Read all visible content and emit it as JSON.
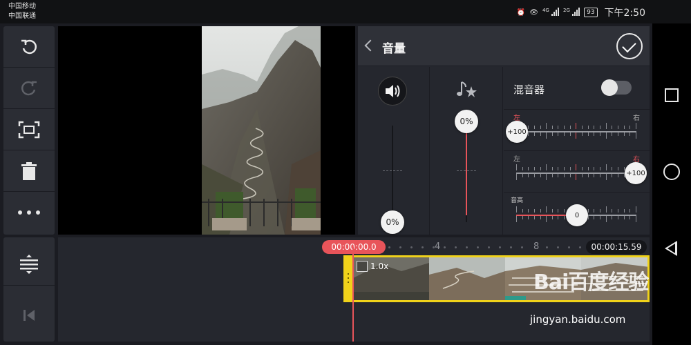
{
  "status_bar": {
    "carrier_1": "中国移动",
    "carrier_2": "中国联通",
    "net_1": "4G",
    "net_2": "2G",
    "battery": "93",
    "time": "下午2:50"
  },
  "left_toolbar": {
    "items": [
      "undo-icon",
      "redo-icon",
      "fit-screen-icon",
      "delete-icon",
      "more-icon"
    ],
    "bottom_items": [
      "split-track-icon",
      "jump-to-start-icon"
    ]
  },
  "volume_panel": {
    "title": "音量",
    "clip_volume": "0%",
    "music_volume": "0%",
    "mixer_label": "混音器",
    "mixer_enabled": false,
    "pan_1": {
      "left_label": "左",
      "right_label": "右",
      "value": "+100",
      "side": "left"
    },
    "pan_2": {
      "left_label": "左",
      "right_label": "右",
      "value": "+100",
      "side": "right"
    },
    "pitch_label": "音高",
    "pitch_value": "0"
  },
  "timeline": {
    "current_time": "00:00:00.0",
    "total_time": "00:00:15.59",
    "marks": [
      "4",
      "8"
    ],
    "speed": "1.0x"
  },
  "watermark": {
    "logo": "Bai百度经验",
    "url": "jingyan.baidu.com"
  },
  "colors": {
    "accent_red": "#e8545a",
    "clip_border": "#f0d21a",
    "panel_bg": "#25272e"
  }
}
